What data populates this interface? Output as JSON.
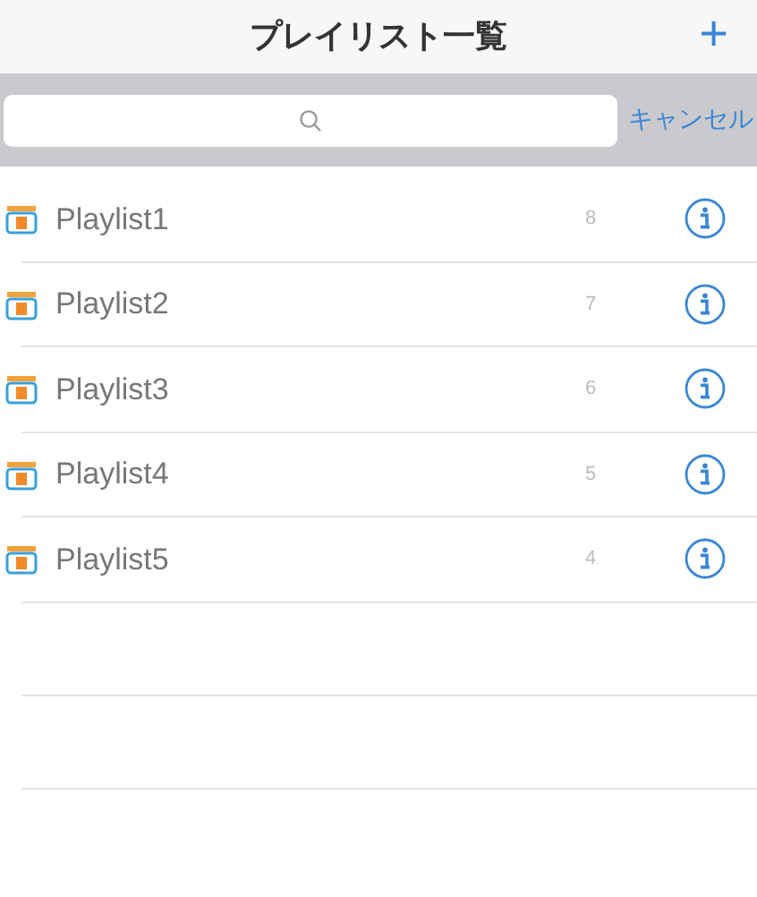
{
  "nav": {
    "title": "プレイリスト一覧",
    "add": "+"
  },
  "search": {
    "cancel": "キャンセル"
  },
  "playlists": [
    {
      "name": "Playlist1",
      "count": "8"
    },
    {
      "name": "Playlist2",
      "count": "7"
    },
    {
      "name": "Playlist3",
      "count": "6"
    },
    {
      "name": "Playlist4",
      "count": "5"
    },
    {
      "name": "Playlist5",
      "count": "4"
    }
  ]
}
